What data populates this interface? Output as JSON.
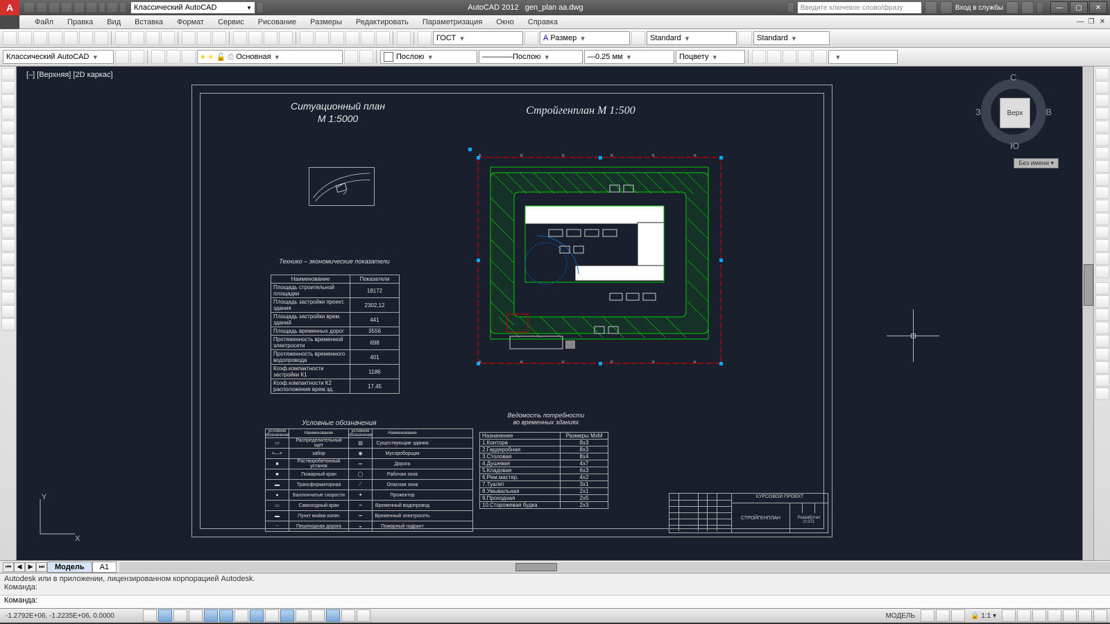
{
  "app": {
    "name": "AutoCAD 2012",
    "doc": "gen_plan aa.dwg"
  },
  "workspace": "Классический AutoCAD",
  "search_placeholder": "Введите ключевое слово/фразу",
  "signin": "Вход в службы",
  "menu": [
    "Файл",
    "Правка",
    "Вид",
    "Вставка",
    "Формат",
    "Сервис",
    "Рисование",
    "Размеры",
    "Редактировать",
    "Параметризация",
    "Окно",
    "Справка"
  ],
  "toolbar2": {
    "standard": "ГОСТ",
    "dim": "Размер",
    "textstyle": "Standard",
    "tablestyle": "Standard"
  },
  "toolbar3": {
    "workspace": "Классический AutoCAD",
    "layer": "Основная",
    "color": "Послою",
    "ltype": "Послою",
    "lweight": "0.25 мм",
    "plotstyle": "Поцвету"
  },
  "viewport_label": "[–] [Верхняя] [2D каркас]",
  "tabs": {
    "model": "Модель",
    "a1": "A1"
  },
  "viewcube": {
    "face": "Верх",
    "n": "С",
    "s": "Ю",
    "e": "В",
    "w": "З",
    "tag": "Без имени"
  },
  "drawing": {
    "sit_title": "Ситуационный план",
    "sit_scale": "М 1:5000",
    "main_title": "Стройгенплан М 1:500",
    "tech_head": "Технико – экономические показатели",
    "tech_cols": {
      "c1": "Наименование",
      "c2": "Показатели"
    },
    "tech_rows": [
      {
        "n": "Площадь строительной площадки",
        "v": "18172"
      },
      {
        "n": "Площадь застройки проект. здания",
        "v": "2302,12"
      },
      {
        "n": "Площадь застройки врем. зданий",
        "v": "441"
      },
      {
        "n": "Площадь временных дорог",
        "v": "3556"
      },
      {
        "n": "Протяженность временной электросети",
        "v": "698"
      },
      {
        "n": "Протяженность временного водопровода",
        "v": "401"
      },
      {
        "n": "Коэф.компактности застройки  К1",
        "v": "1186"
      },
      {
        "n": "Коэф.компактности К2 расположения врем.зд.",
        "v": "17.45"
      }
    ],
    "leg_head": "Условные обозначения",
    "leg_cols": {
      "s": "условное обозначение",
      "n": "Наименование"
    },
    "leg_left": [
      {
        "n": "Распределительный щит"
      },
      {
        "n": "забор"
      },
      {
        "n": "Растворобетонный устанок"
      },
      {
        "n": "Пожарный кран"
      },
      {
        "n": "Трансформаторная"
      },
      {
        "n": "Баллончатые скорости"
      },
      {
        "n": "Самоходный кран"
      },
      {
        "n": "Пункт мойки колес"
      },
      {
        "n": "Пешеходная дорога"
      }
    ],
    "leg_right": [
      {
        "n": "Существующие здания"
      },
      {
        "n": "Мусороборщик"
      },
      {
        "n": "Дорога"
      },
      {
        "n": "Рабочая зона"
      },
      {
        "n": "Опасная зона"
      },
      {
        "n": "Прожектор"
      },
      {
        "n": "Временный водопровод"
      },
      {
        "n": "Временный электросеть"
      },
      {
        "n": "Пожарный гидрант"
      }
    ],
    "ved_head1": "Ведомость потребности",
    "ved_head2": "во временных зданиях",
    "ved_cols": {
      "c1": "Назначение",
      "c2": "Размеры МхМ"
    },
    "ved_rows": [
      {
        "n": "1.Контора",
        "v": "8х3"
      },
      {
        "n": "2.Гардеробная",
        "v": "8х3"
      },
      {
        "n": "3.Столовая",
        "v": "8х4"
      },
      {
        "n": "4.Душевая",
        "v": "4х7"
      },
      {
        "n": "5.Кладовая",
        "v": "6х3"
      },
      {
        "n": "6.Рем.мастер.",
        "v": "4х2"
      },
      {
        "n": "7.Туалет",
        "v": "3х1"
      },
      {
        "n": "8.Умывальная",
        "v": "2х1"
      },
      {
        "n": "9.Проходная",
        "v": "2х5"
      },
      {
        "n": "10.Сторожевая будка",
        "v": "2х3"
      }
    ],
    "stamp": {
      "title": "КУРСОВОЙ ПРОЕКТ",
      "sheet": "СТРОЙГЕНПЛАН"
    }
  },
  "cmd": {
    "log1": "Autodesk или в приложении, лицензированном корпорацией Autodesk.",
    "log2": "Команда:",
    "prompt": "Команда:"
  },
  "status": {
    "coords": "-1.2792E+06, -1.2235E+06, 0.0000",
    "model_btn": "МОДЕЛЬ",
    "scale": "1:1"
  }
}
